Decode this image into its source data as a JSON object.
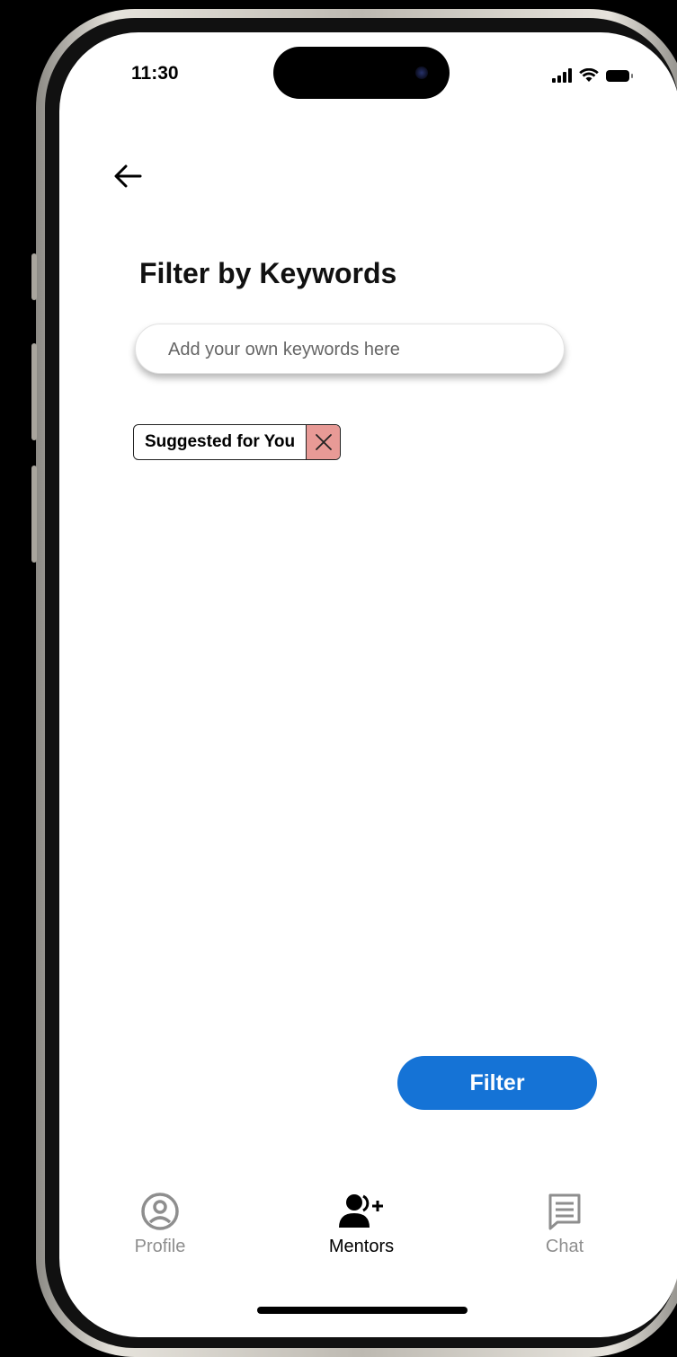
{
  "status_bar": {
    "time": "11:30",
    "icons": [
      "signal-icon",
      "wifi-icon",
      "battery-icon"
    ]
  },
  "header": {
    "back_icon": "back-arrow-icon"
  },
  "main": {
    "title": "Filter by Keywords",
    "search": {
      "placeholder": "Add your own keywords here",
      "value": ""
    },
    "chips": [
      {
        "label": "Suggested for You",
        "remove_icon": "close-icon",
        "remove_color": "#e89a96"
      }
    ],
    "filter_button_label": "Filter"
  },
  "bottom_nav": {
    "items": [
      {
        "label": "Profile",
        "icon": "profile-icon",
        "active": false
      },
      {
        "label": "Mentors",
        "icon": "add-mentor-icon",
        "active": true
      },
      {
        "label": "Chat",
        "icon": "chat-icon",
        "active": false
      }
    ]
  },
  "colors": {
    "accent": "#1573d6",
    "chip_close": "#e89a96",
    "inactive_nav": "#8e8e8e",
    "active_nav": "#000000"
  }
}
